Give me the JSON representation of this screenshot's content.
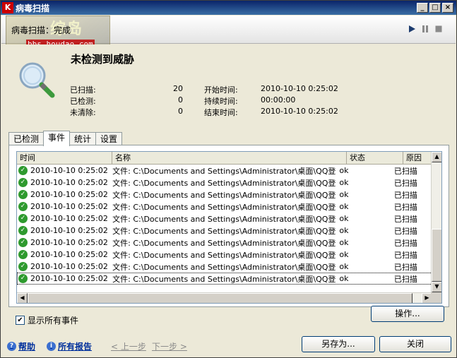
{
  "window": {
    "title": "病毒扫描",
    "app_icon_glyph": "K",
    "controls": {
      "minimize": "_",
      "maximize": "□",
      "close": "×"
    }
  },
  "header": {
    "status": "病毒扫描：完成",
    "watermark_text": "综岛",
    "watermark_url": "bbs.houdao.com",
    "media_icons": [
      "play-icon",
      "pause-icon",
      "stop-icon"
    ]
  },
  "summary": {
    "heading": "未检测到威胁",
    "scanned_label": "已扫描:",
    "scanned_value": "20",
    "detected_label": "已检测:",
    "detected_value": "0",
    "uncleaned_label": "未清除:",
    "uncleaned_value": "0",
    "start_label": "开始时间:",
    "start_value": "2010-10-10 0:25:02",
    "duration_label": "持续时间:",
    "duration_value": "00:00:00",
    "end_label": "结束时间:",
    "end_value": "2010-10-10 0:25:02"
  },
  "tabs": [
    "已检测",
    "事件",
    "统计",
    "设置"
  ],
  "active_tab": "事件",
  "events": {
    "columns": [
      "时间",
      "名称",
      "状态",
      "原因"
    ],
    "rows": [
      {
        "time": "2010-10-10 0:25:02",
        "name": "文件: C:\\Documents and Settings\\Administrator\\桌面\\QQ登录助...",
        "state": "ok",
        "reason": "已扫描"
      },
      {
        "time": "2010-10-10 0:25:02",
        "name": "文件: C:\\Documents and Settings\\Administrator\\桌面\\QQ登录助...",
        "state": "ok",
        "reason": "已扫描"
      },
      {
        "time": "2010-10-10 0:25:02",
        "name": "文件: C:\\Documents and Settings\\Administrator\\桌面\\QQ登录助...",
        "state": "ok",
        "reason": "已扫描"
      },
      {
        "time": "2010-10-10 0:25:02",
        "name": "文件: C:\\Documents and Settings\\Administrator\\桌面\\QQ登录助...",
        "state": "ok",
        "reason": "已扫描"
      },
      {
        "time": "2010-10-10 0:25:02",
        "name": "文件: C:\\Documents and Settings\\Administrator\\桌面\\QQ登录助...",
        "state": "ok",
        "reason": "已扫描"
      },
      {
        "time": "2010-10-10 0:25:02",
        "name": "文件: C:\\Documents and Settings\\Administrator\\桌面\\QQ登录助...",
        "state": "ok",
        "reason": "已扫描"
      },
      {
        "time": "2010-10-10 0:25:02",
        "name": "文件: C:\\Documents and Settings\\Administrator\\桌面\\QQ登录助...",
        "state": "ok",
        "reason": "已扫描"
      },
      {
        "time": "2010-10-10 0:25:02",
        "name": "文件: C:\\Documents and Settings\\Administrator\\桌面\\QQ登录助...",
        "state": "ok",
        "reason": "已扫描"
      },
      {
        "time": "2010-10-10 0:25:02",
        "name": "文件: C:\\Documents and Settings\\Administrator\\桌面\\QQ登录助...",
        "state": "ok",
        "reason": "已扫描"
      },
      {
        "time": "2010-10-10 0:25:02",
        "name": "文件: C:\\Documents and Settings\\Administrator\\桌面\\QQ登录助...",
        "state": "ok",
        "reason": "已扫描"
      }
    ]
  },
  "show_all_events": {
    "label": "显示所有事件",
    "checked": true
  },
  "buttons": {
    "actions": "操作...",
    "save_as": "另存为...",
    "close": "关闭"
  },
  "footer": {
    "help": "帮助",
    "all_reports": "所有报告",
    "prev": "< 上一步",
    "next": "下一步 >"
  },
  "colors": {
    "title_start": "#0a246a",
    "title_end": "#3a6ea5",
    "ok_green": "#2e9a2e",
    "link_blue": "#00309c"
  }
}
